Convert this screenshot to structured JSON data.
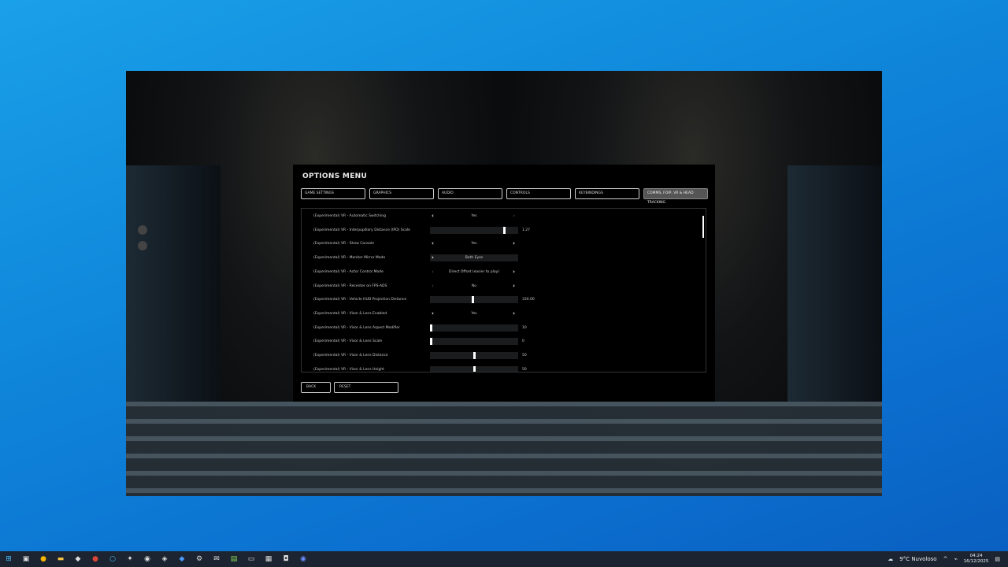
{
  "menu": {
    "title": "OPTIONS MENU",
    "tabs": [
      "GAME SETTINGS",
      "GRAPHICS",
      "AUDIO",
      "CONTROLS",
      "KEYBINDINGS",
      "COMMS, FOIP, VR & HEAD TRACKING"
    ],
    "active_tab": 5,
    "rows": [
      {
        "label": "(Experimental) VR - Automatic Switching",
        "type": "choice",
        "value": "Yes",
        "left_enabled": true,
        "right_enabled": false
      },
      {
        "label": "(Experimental) VR - Interpupillary Distance (IPD) Scale",
        "type": "slider",
        "value": "1.27",
        "fill": 0.85
      },
      {
        "label": "(Experimental) VR - Show Console",
        "type": "choice",
        "value": "Yes",
        "left_enabled": true,
        "right_enabled": true
      },
      {
        "label": "(Experimental) VR - Monitor Mirror Mode",
        "type": "box",
        "value": "Both Eyes"
      },
      {
        "label": "(Experimental) VR - Actor Control Mode",
        "type": "choice",
        "value": "Direct Offset (easier to play)",
        "left_enabled": false,
        "right_enabled": true
      },
      {
        "label": "(Experimental) VR - Recenter on FPS-ADS",
        "type": "choice",
        "value": "No",
        "left_enabled": false,
        "right_enabled": true
      },
      {
        "label": "(Experimental) VR - Vehicle HUD Projection Distance",
        "type": "slider",
        "value": "330.00",
        "fill": 0.49
      },
      {
        "label": "(Experimental) VR - Visor & Lens Enabled",
        "type": "choice",
        "value": "Yes",
        "left_enabled": true,
        "right_enabled": true
      },
      {
        "label": "(Experimental) VR - Visor & Lens Aspect Modifier",
        "type": "slider",
        "value": "10",
        "fill": 0.0
      },
      {
        "label": "(Experimental) VR - Visor & Lens Scale",
        "type": "slider",
        "value": "0",
        "fill": 0.0
      },
      {
        "label": "(Experimental) VR - Visor & Lens Distance",
        "type": "slider",
        "value": "50",
        "fill": 0.5
      },
      {
        "label": "(Experimental) VR - Visor & Lens Height",
        "type": "slider",
        "value": "50",
        "fill": 0.5
      }
    ],
    "back_label": "BACK",
    "reset_label": "RESET"
  },
  "taskbar": {
    "weather": "9°C  Nuvoloso",
    "time": "04:24",
    "date": "16/12/2025"
  }
}
